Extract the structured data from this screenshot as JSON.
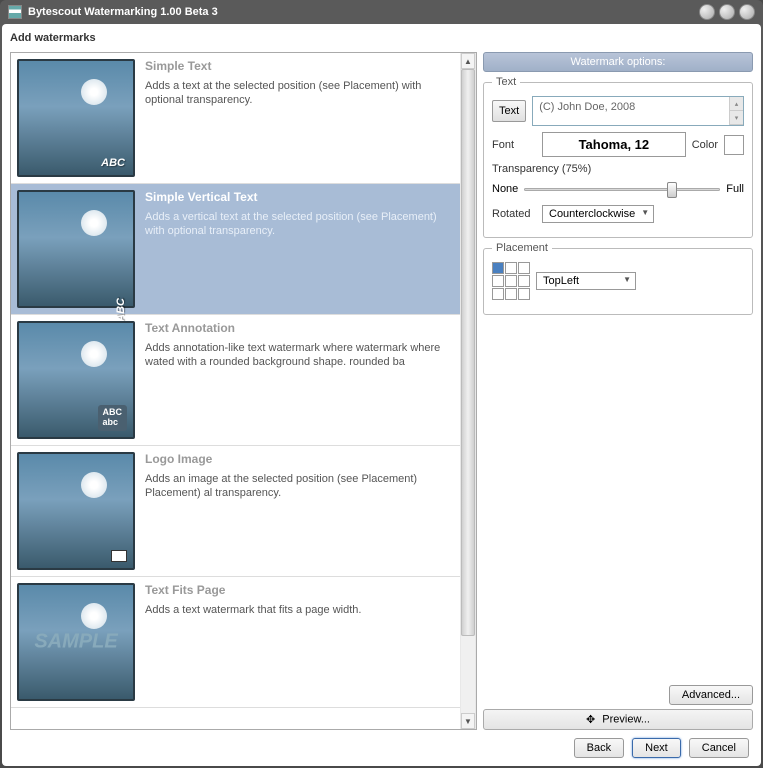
{
  "window": {
    "title": "Bytescout Watermarking 1.00 Beta 3"
  },
  "header": "Add watermarks",
  "list": [
    {
      "title": "Simple Text",
      "desc": "Adds a text at the selected position (see Placement) with optional transparency.",
      "thumb_text": "ABC"
    },
    {
      "title": "Simple Vertical Text",
      "desc": "Adds a vertical text at the selected position (see Placement) with optional transparency.",
      "thumb_text": "ABC",
      "selected": true
    },
    {
      "title": "Text Annotation",
      "desc": "Adds annotation-like text watermark where watermark where wated with a rounded background shape. rounded ba",
      "thumb_badge": "ABC\nabc"
    },
    {
      "title": "Logo Image",
      "desc": "Adds an image at the selected position (see Placement) Placement) al transparency."
    },
    {
      "title": "Text Fits Page",
      "desc": "Adds a text watermark that fits a page width.",
      "thumb_sample": "SAMPLE"
    }
  ],
  "options": {
    "header": "Watermark options:",
    "text_group": "Text",
    "text_btn": "Text",
    "text_value": "(C) John Doe, 2008",
    "font_label": "Font",
    "font_value": "Tahoma, 12",
    "color_label": "Color",
    "transparency_label": "Transparency (75%)",
    "slider_min": "None",
    "slider_max": "Full",
    "rotated_label": "Rotated",
    "rotated_value": "Counterclockwise",
    "placement_group": "Placement",
    "placement_value": "TopLeft",
    "advanced": "Advanced...",
    "preview": "Preview..."
  },
  "buttons": {
    "back": "Back",
    "next": "Next",
    "cancel": "Cancel"
  }
}
